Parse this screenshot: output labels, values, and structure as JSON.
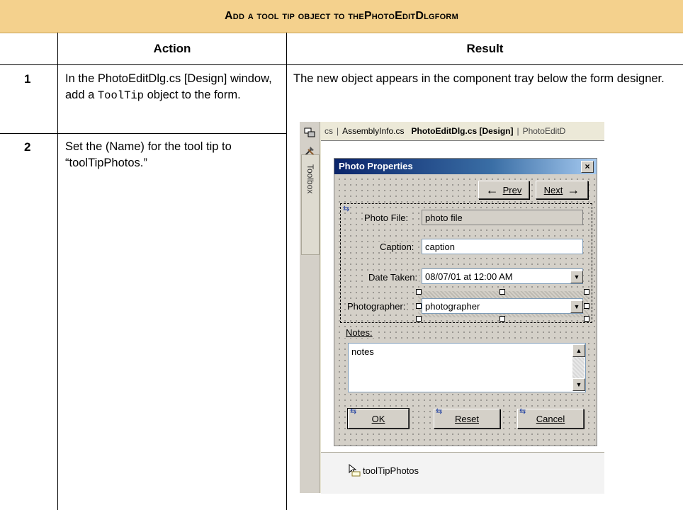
{
  "table": {
    "title_prefix": "Add a tool tip object to the ",
    "title_form": "PhotoEditDlg",
    "title_suffix": " form",
    "header_action": "Action",
    "header_result": "Result",
    "steps": [
      {
        "num": "1",
        "text_pre": "In the PhotoEditDlg.cs [Design] window, add a ",
        "code": "ToolTip",
        "text_post": " object to the form."
      },
      {
        "num": "2",
        "text": "Set the (Name) for the tool tip to “toolTipPhotos.”"
      }
    ],
    "result_text": "The new object appears in the component tray below the form designer."
  },
  "ide": {
    "tabs": [
      {
        "label": "cs",
        "state": "partial"
      },
      {
        "label": "AssemblyInfo.cs",
        "state": "normal"
      },
      {
        "label": "PhotoEditDlg.cs [Design]",
        "state": "active"
      },
      {
        "label": "PhotoEditD",
        "state": "partial"
      }
    ],
    "toolbox_label": "Toolbox",
    "toolbox_icons": [
      "server-explorer-icon",
      "toolbox-tools-icon"
    ]
  },
  "form": {
    "title": "Photo Properties",
    "close_glyph": "×",
    "prev_label": "Prev",
    "prev_mnemonic": "v",
    "next_label": "Next",
    "next_mnemonic": "x",
    "photo_file_label": "Photo File:",
    "photo_file_value": "photo file",
    "caption_label": "Caption:",
    "caption_value": "caption",
    "date_taken_label": "Date Taken:",
    "date_taken_value": "08/07/01 at 12:00 AM",
    "photographer_label": "Photographer:",
    "photographer_value": "photographer",
    "notes_label": "Notes:",
    "notes_value": "notes",
    "ok_label": "OK",
    "reset_label": "Reset",
    "cancel_label": "Cancel"
  },
  "tray": {
    "component_name": "toolTipPhotos",
    "component_icon": "tooltip-component-icon"
  },
  "colors": {
    "title_band": "#f4d18d",
    "form_titlebar_start": "#0a246a",
    "form_face": "#d4d0c8"
  }
}
